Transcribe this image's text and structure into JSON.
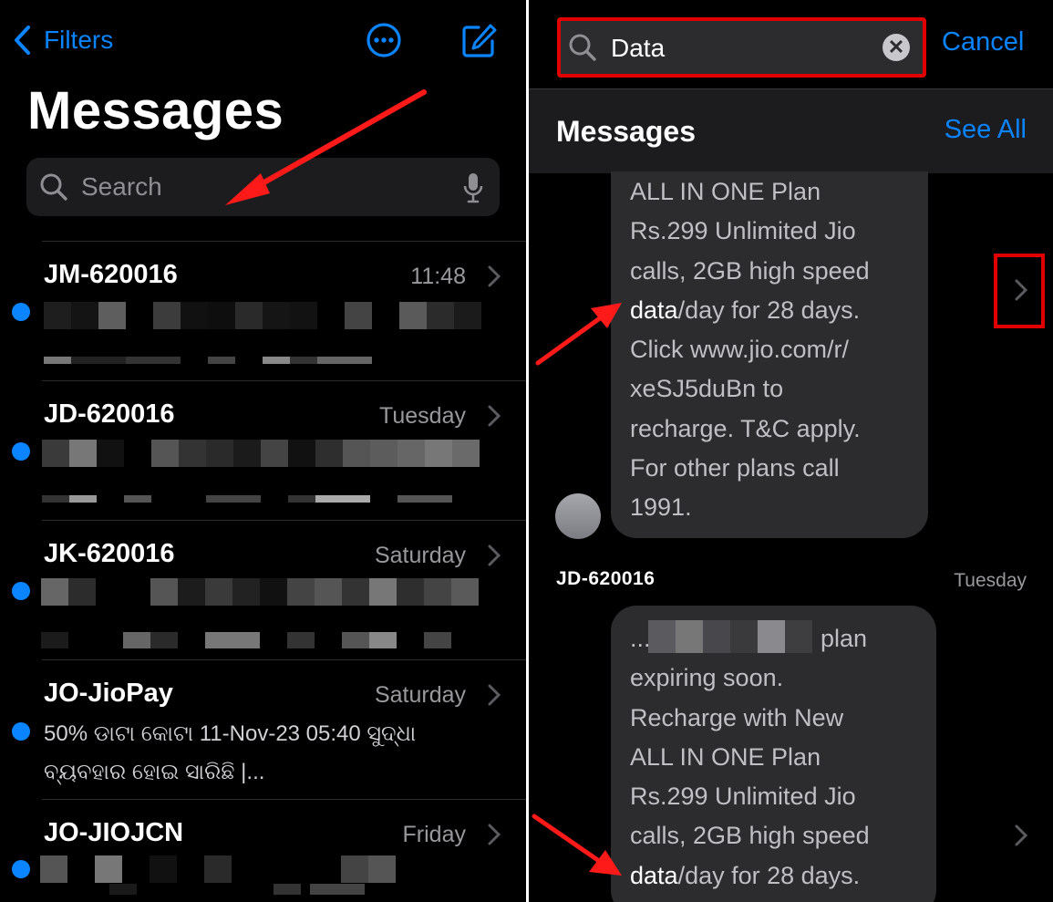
{
  "left": {
    "nav": {
      "back_label": "Filters"
    },
    "title": "Messages",
    "search": {
      "placeholder": "Search"
    },
    "conversations": [
      {
        "sender": "JM-620016",
        "time": "11:48",
        "preview": "",
        "unread": true
      },
      {
        "sender": "JD-620016",
        "time": "Tuesday",
        "preview": "",
        "unread": true
      },
      {
        "sender": "JK-620016",
        "time": "Saturday",
        "preview": "",
        "unread": true
      },
      {
        "sender": "JO-JioPay",
        "time": "Saturday",
        "preview": "50% ଡାଟା କୋଟା 11-Nov-23 05:40 ସୁଦ୍ଧା ବ୍ୟବହାର ହୋଇ ସାରିଛି |...",
        "unread": true
      },
      {
        "sender": "JO-JIOJCN",
        "time": "Friday",
        "preview": "",
        "unread": true
      }
    ]
  },
  "right": {
    "search": {
      "value": "Data"
    },
    "cancel_label": "Cancel",
    "section": {
      "title": "Messages",
      "see_all": "See All"
    },
    "results": [
      {
        "lines": [
          "ALL IN ONE Plan",
          "Rs.299 Unlimited Jio",
          "calls, 2GB high speed",
          "",
          "Click www.jio.com/r/",
          "xeSJ5duBn to",
          "recharge. T&C apply.",
          "For other plans call",
          "1991."
        ],
        "match_word": "data",
        "match_rest": "/day for 28 days."
      },
      {
        "sender": "JD-620016",
        "time": "Tuesday",
        "lines": [
          "...",
          "expiring soon.",
          "Recharge with New",
          "ALL IN ONE Plan",
          "Rs.299 Unlimited Jio",
          "calls, 2GB high speed"
        ],
        "first_line_tail": "plan",
        "match_word": "data",
        "match_rest": "/day for 28 days."
      }
    ]
  },
  "colors": {
    "accent": "#0a84ff",
    "highlight": "#e10000",
    "background": "#000000"
  }
}
